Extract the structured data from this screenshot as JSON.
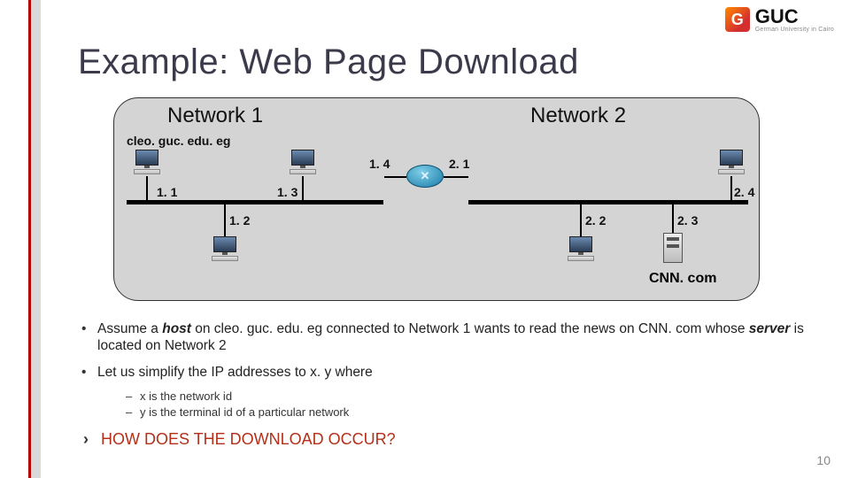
{
  "logo": {
    "mark": "G",
    "top": "GUC",
    "bottom": "German University in Cairo"
  },
  "title": "Example: Web Page Download",
  "diagram": {
    "net1": "Network 1",
    "net2": "Network 2",
    "host1": "cleo. guc. edu. eg",
    "host2": "CNN. com",
    "ips": {
      "n1a": "1. 1",
      "n1b": "1. 2",
      "n1c": "1. 3",
      "n1r": "1. 4",
      "n2r": "2. 1",
      "n2a": "2. 2",
      "n2b": "2. 3",
      "n2c": "2. 4"
    }
  },
  "bullets": {
    "b1a": "Assume a ",
    "b1_host": "host",
    "b1b": " on cleo. guc. edu. eg connected to Network 1 wants to read the news on CNN. com whose ",
    "b1_server": "server",
    "b1c": " is located on Network 2",
    "b2": "Let us simplify the IP addresses to x. y where",
    "s1": "x is the network id",
    "s2": "y is the terminal id of a particular network"
  },
  "question": "HOW DOES THE DOWNLOAD OCCUR?",
  "page": "10"
}
